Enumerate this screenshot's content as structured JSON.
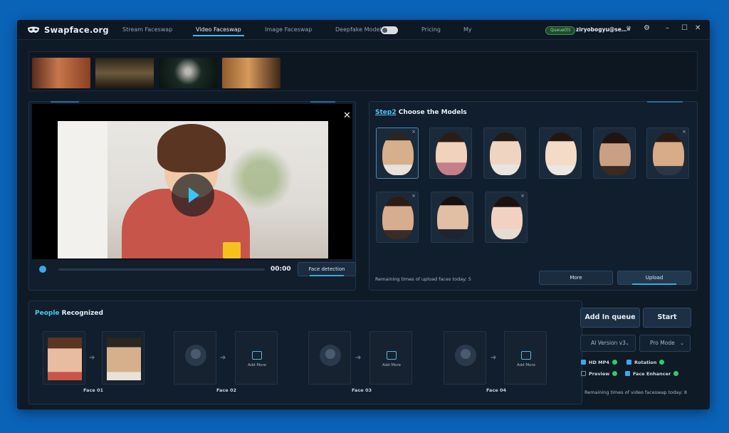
{
  "app": {
    "name": "Swapface.org",
    "nav": [
      {
        "label": "Stream Faceswap",
        "active": false
      },
      {
        "label": "Video Faceswap",
        "active": true
      },
      {
        "label": "Image Faceswap",
        "active": false
      },
      {
        "label": "Deepfake Model",
        "active": false
      },
      {
        "label": "Pricing",
        "active": false
      },
      {
        "label": "My",
        "active": false
      }
    ],
    "queue_badge": "Queue(0)",
    "user": "ziryobogyu@se…"
  },
  "video": {
    "time": "00:00",
    "face_detection_label": "Face detection"
  },
  "models_panel": {
    "step_label": "Step2",
    "title": "Choose the Models",
    "remaining_text": "Remaining times of upload faces today: 5",
    "more_label": "More",
    "upload_label": "Upload"
  },
  "people": {
    "title_highlight": "People",
    "title_rest": "Recognized",
    "faces": [
      {
        "label": "Face 01"
      },
      {
        "label": "Face 02",
        "add_more": "Add More"
      },
      {
        "label": "Face 03",
        "add_more": "Add More"
      },
      {
        "label": "Face 04",
        "add_more": "Add More"
      }
    ]
  },
  "actions": {
    "add_queue_label": "Add In queue",
    "start_label": "Start",
    "ai_version": "AI Version v3",
    "mode": "Pro Mode",
    "options": [
      {
        "label": "HD MP4",
        "checked": true
      },
      {
        "label": "Rotation",
        "checked": true
      },
      {
        "label": "Preview",
        "checked": false
      },
      {
        "label": "Face Enhancer",
        "checked": true
      }
    ],
    "remaining_text": "Remaining times of video faceswap today: 8"
  },
  "colors": {
    "accent": "#3fb8e8",
    "background": "#0b63b8",
    "window": "#0f1a27"
  }
}
